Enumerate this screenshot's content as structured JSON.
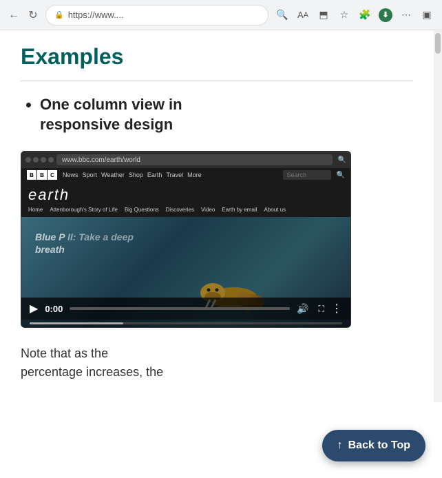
{
  "browser": {
    "url": "https://www....",
    "back_label": "←",
    "reload_label": "↻",
    "zoom_icon": "🔍",
    "font_icon": "A",
    "cast_icon": "⬒",
    "bookmark_icon": "☆",
    "extension_icon": "🔧",
    "profile_icon": "👤",
    "download_icon": "⬇",
    "menu_icon": "⋯",
    "sidebar_icon": "▣"
  },
  "page": {
    "title": "Examples",
    "list_item_1_line1": "One column view in",
    "list_item_1_line2": "responsive design",
    "note_text": "Note that as the",
    "note_text2": "percentage increases, the"
  },
  "video": {
    "inner_browser_url": "www.bbc.com/earth/world",
    "bbc_nav_links": [
      "News",
      "Sport",
      "Weather",
      "Shop",
      "Earth",
      "Travel",
      "More"
    ],
    "bbc_search_placeholder": "Search",
    "earth_logo": "earth",
    "earth_nav_links": [
      "Home",
      "Attenborough's Story of Life",
      "Big Questions",
      "Discoveries",
      "Video",
      "Earth by email",
      "About us"
    ],
    "video_title_line1": "Blue P",
    "video_title_line2": "breath",
    "video_subtitle": "II: Take a deep",
    "time": "0:00",
    "progress_percent": 0
  },
  "back_to_top": {
    "label": "Back to Top",
    "arrow": "↑"
  }
}
